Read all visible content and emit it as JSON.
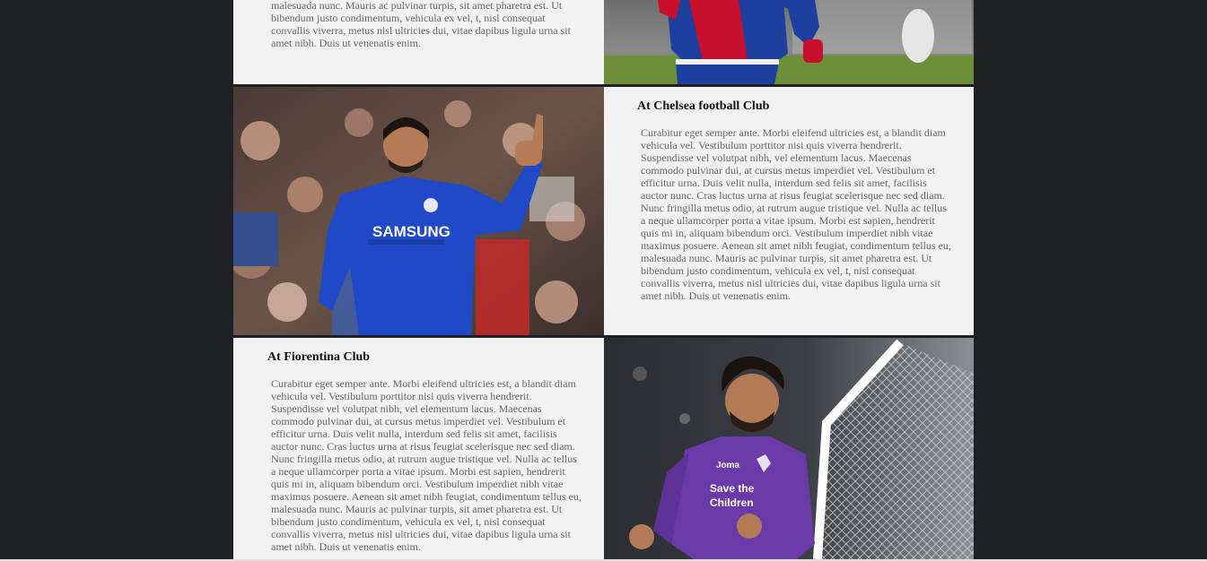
{
  "sections": [
    {
      "id": "top-partial",
      "paragraph_lines": [
        "malesuada nunc. Mauris ac pulvinar turpis, sit amet pharetra est. Ut",
        "bibendum justo condimentum, vehicula ex vel, t, nisl consequat",
        "convallis viverra, metus nisl ultricies dui, vitae dapibus ligula urna sit",
        "amet nibh. Duis ut venenatis enim."
      ],
      "image": "salah-basel-photo"
    },
    {
      "id": "chelsea",
      "title": "At Chelsea football Club",
      "paragraph_lines": [
        "Curabitur eget semper ante. Morbi eleifend ultricies est, a blandit diam",
        "vehicula vel. Vestibulum porttitor nisi quis viverra hendrerit.",
        "Suspendisse vel volutpat nibh, vel elementum lacus. Maecenas",
        "commodo pulvinar dui, at cursus metus imperdiet vel. Vestibulum et",
        "efficitur urna. Duis velit nulla, interdum sed felis sit amet, facilisis",
        "auctor nunc. Cras luctus urna at risus feugiat scelerisque nec sed diam.",
        "Nunc fringilla metus odio, at rutrum augue tristique vel. Nulla ac tellus",
        "a neque ullamcorper porta a vitae ipsum. Morbi est sapien, hendrerit",
        "quis mi in, aliquam bibendum orci. Vestibulum imperdiet nibh vitae",
        "maximus posuere. Aenean sit amet nibh feugiat, condimentum tellus eu,",
        "malesuada nunc. Mauris ac pulvinar turpis, sit amet pharetra est. Ut",
        "bibendum justo condimentum, vehicula ex vel, t, nisl consequat",
        "convallis viverra, metus nisl ultricies dui, vitae dapibus ligula urna sit",
        "amet nibh. Duis ut venenatis enim."
      ],
      "image": "salah-chelsea-photo",
      "shirt_text": "SAMSUNG"
    },
    {
      "id": "fiorentina",
      "title": "At Fiorentina Club",
      "paragraph_lines": [
        "Curabitur eget semper ante. Morbi eleifend ultricies est, a blandit diam",
        "vehicula vel. Vestibulum porttitor nisi quis viverra hendrerit.",
        "Suspendisse vel volutpat nibh, vel elementum lacus. Maecenas",
        "commodo pulvinar dui, at cursus metus imperdiet vel. Vestibulum et",
        "efficitur urna. Duis velit nulla, interdum sed felis sit amet, facilisis",
        "auctor nunc. Cras luctus urna at risus feugiat scelerisque nec sed diam.",
        "Nunc fringilla metus odio, at rutrum augue tristique vel. Nulla ac tellus",
        "a neque ullamcorper porta a vitae ipsum. Morbi est sapien, hendrerit",
        "quis mi in, aliquam bibendum orci. Vestibulum imperdiet nibh vitae",
        "maximus posuere. Aenean sit amet nibh feugiat, condimentum tellus eu,",
        "malesuada nunc. Mauris ac pulvinar turpis, sit amet pharetra est. Ut",
        "bibendum justo condimentum, vehicula ex vel, t, nisl consequat",
        "convallis viverra, metus nisl ultricies dui, vitae dapibus ligula urna sit",
        "amet nibh. Duis ut venenatis enim."
      ],
      "image": "salah-fiorentina-photo",
      "shirt_text_1": "Joma",
      "shirt_text_2": "Save the",
      "shirt_text_3": "Children"
    }
  ],
  "colors": {
    "page_background": "#1f2023",
    "text_panel": "#f2f2f2",
    "heading": "#111111",
    "body_text": "#666666",
    "basel_red": "#c8102e",
    "basel_blue": "#1d3f9e",
    "chelsea_blue": "#1f49c7",
    "fiorentina_purple": "#6a3aa8"
  }
}
